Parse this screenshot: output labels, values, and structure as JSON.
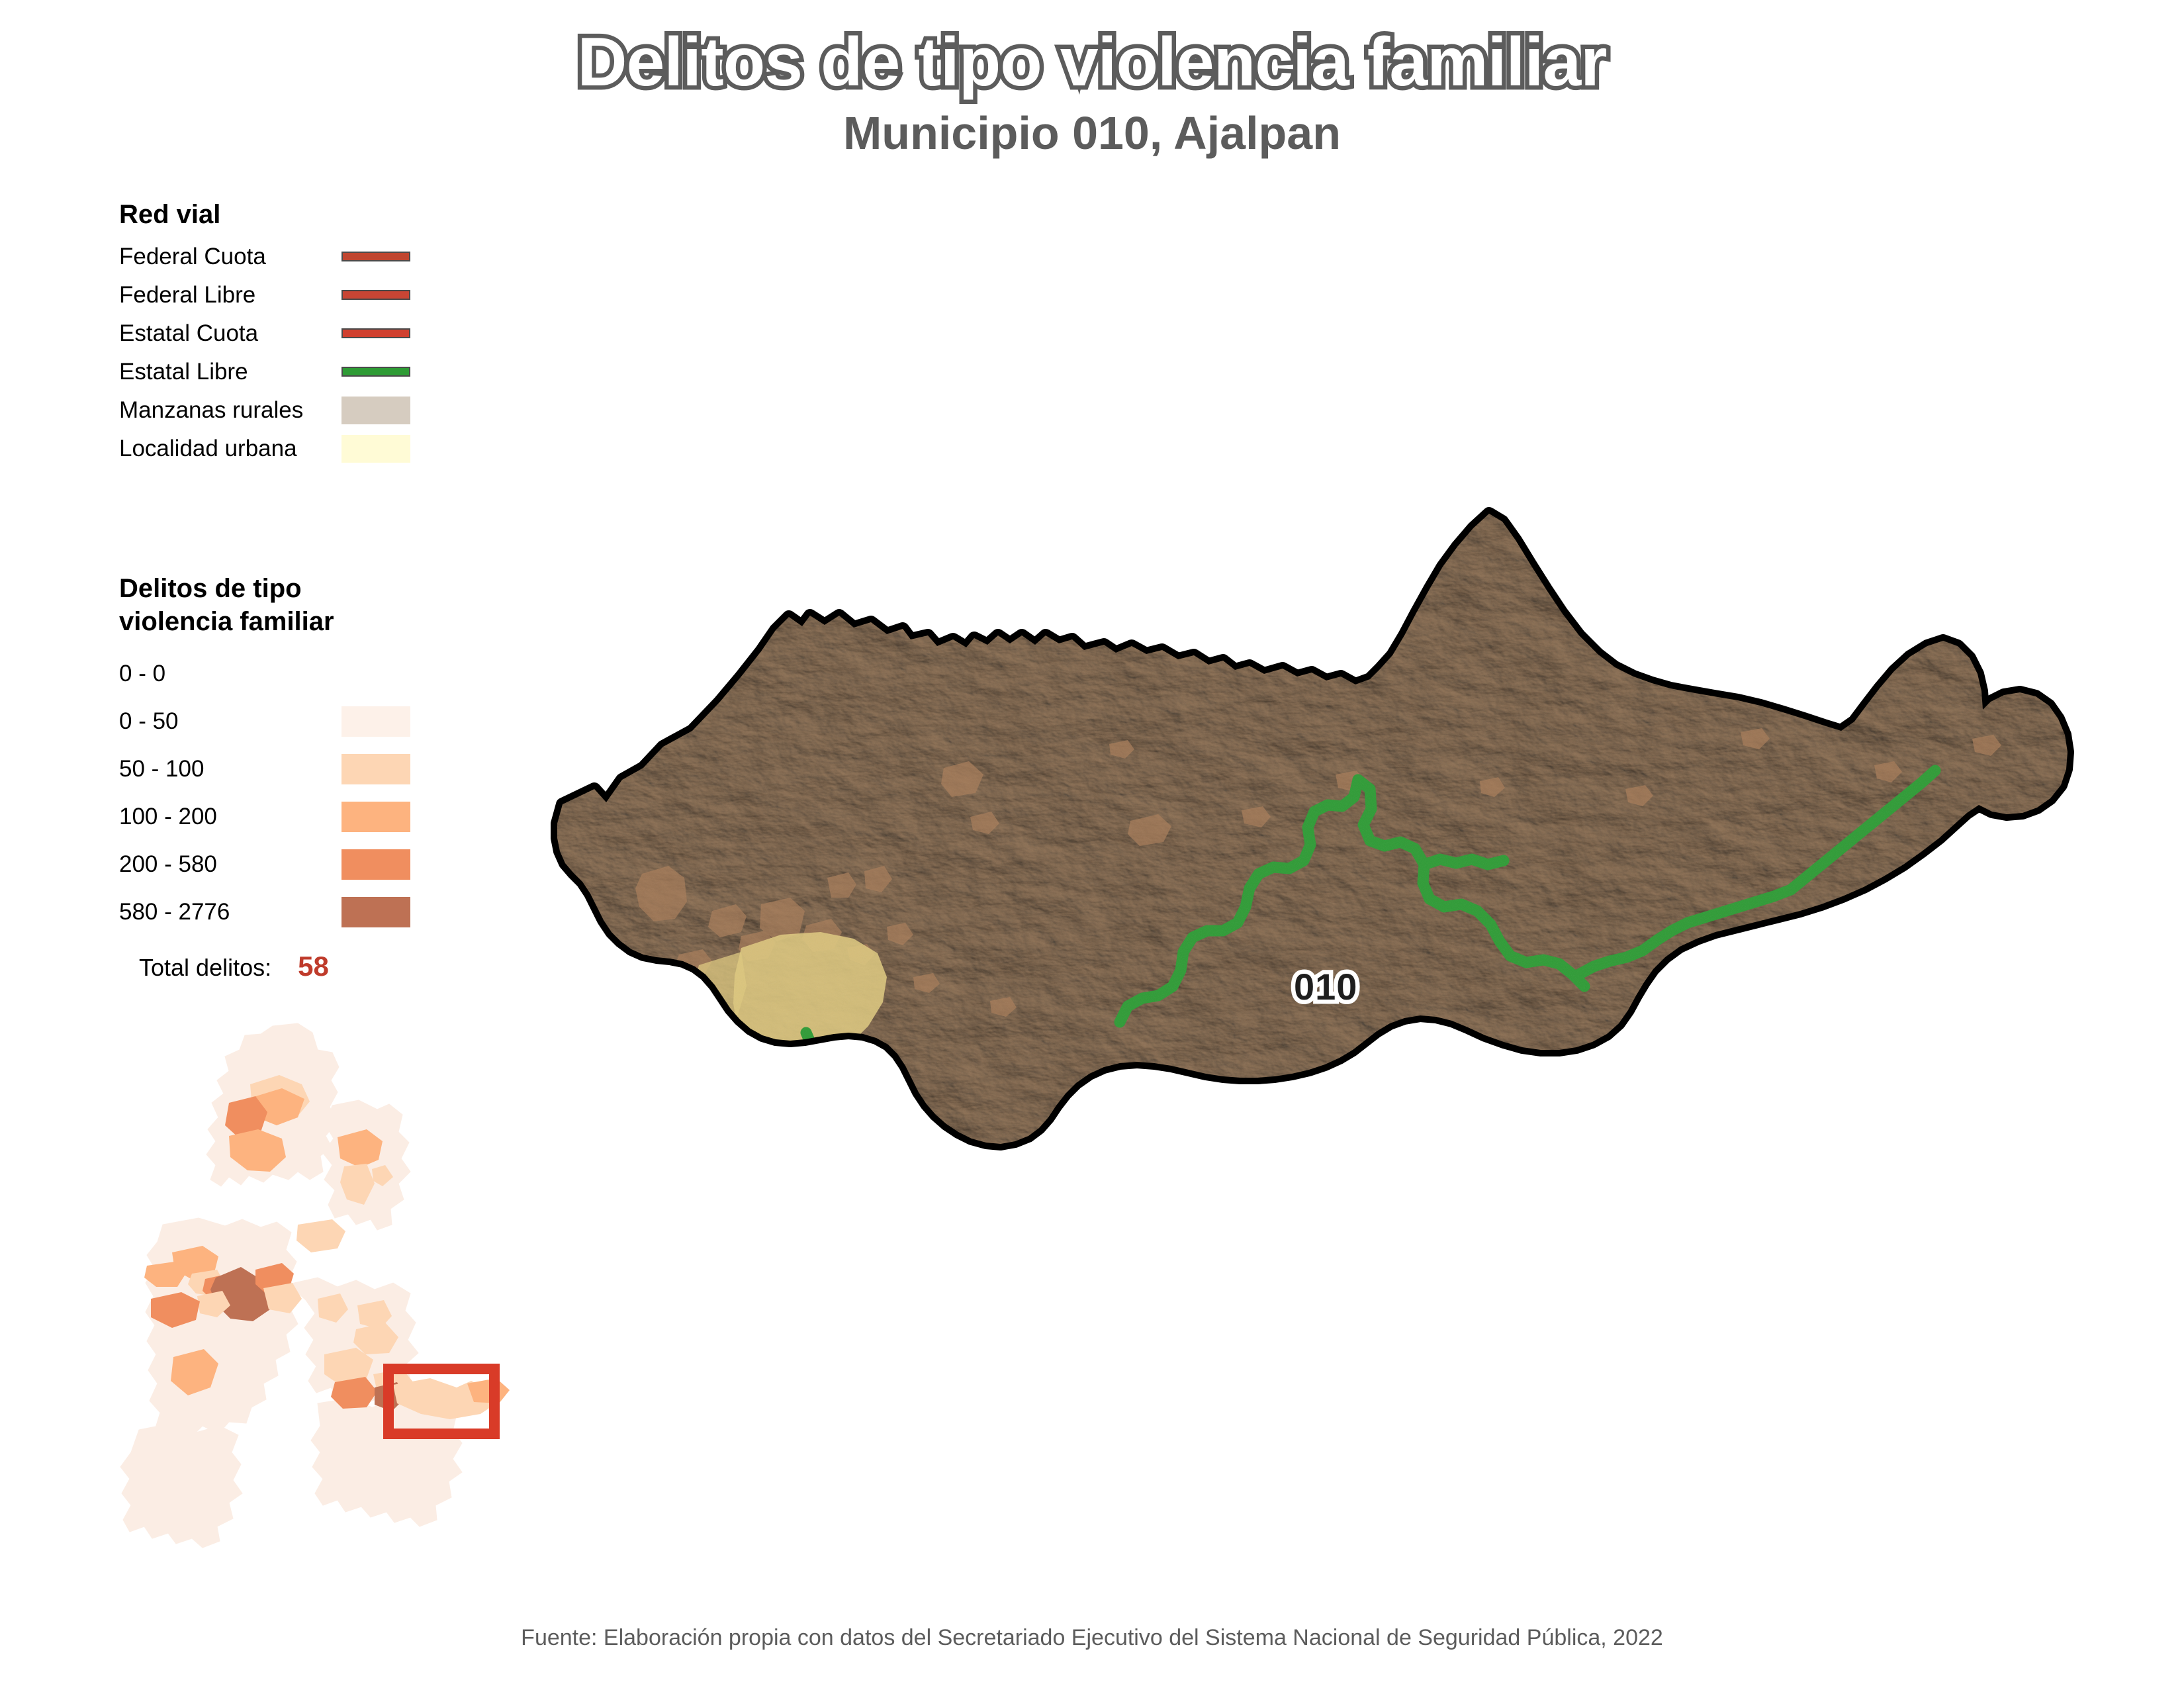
{
  "header": {
    "title": "Delitos de tipo violencia familiar",
    "subtitle": "Municipio 010, Ajalpan",
    "title_fill": "#ffffff",
    "title_stroke": "#5c5c5c",
    "subtitle_color": "#5c5c5c"
  },
  "legend_roads": {
    "heading": "Red vial",
    "items": [
      {
        "label": "Federal Cuota",
        "swatch_type": "line",
        "color": "#C0452F"
      },
      {
        "label": "Federal Libre",
        "swatch_type": "line",
        "color": "#C84534"
      },
      {
        "label": "Estatal Cuota",
        "swatch_type": "line",
        "color": "#D0402F"
      },
      {
        "label": "Estatal Libre",
        "swatch_type": "line",
        "color": "#2E9B35"
      },
      {
        "label": "Manzanas rurales",
        "swatch_type": "box",
        "color": "#D6CCC0"
      },
      {
        "label": "Localidad urbana",
        "swatch_type": "box",
        "color": "#FFFBD6"
      }
    ]
  },
  "legend_choropleth": {
    "heading": "Delitos de tipo violencia familiar",
    "classes": [
      {
        "label": "0 - 0",
        "color": null
      },
      {
        "label": "0 - 50",
        "color": "#FDF1E9"
      },
      {
        "label": "50 - 100",
        "color": "#FDD6B4"
      },
      {
        "label": "100 - 200",
        "color": "#FDB37F"
      },
      {
        "label": "200 - 580",
        "color": "#F08E5F"
      },
      {
        "label": "580 - 2776",
        "color": "#BE7154"
      }
    ],
    "total_label": "Total delitos:",
    "total_value": "58",
    "total_value_color": "#bf3b2b"
  },
  "main_map": {
    "municipio_label": "010",
    "boundary_color": "#000000",
    "boundary_halo": "#ffffff",
    "terrain_base": "#B69878",
    "terrain_shadow": "#6E5B46",
    "urban_locality_color": "#DEC87E",
    "rural_block_color": "#A87C58",
    "state_road_color": "#2E9B35"
  },
  "inset_map": {
    "base_fill": "#FBEDE4",
    "highlight_box_color": "#D93B28",
    "municipality_fills": [
      "#FDF1E9",
      "#FDD6B4",
      "#FDB37F",
      "#F08E5F",
      "#BE7154"
    ]
  },
  "footer": {
    "source": "Fuente: Elaboración propia con datos del Secretariado Ejecutivo del Sistema Nacional de Seguridad Pública, 2022"
  },
  "chart_data": {
    "type": "map",
    "title": "Delitos de tipo violencia familiar",
    "subtitle": "Municipio 010, Ajalpan",
    "measure": "Delitos de tipo violencia familiar",
    "total": 58,
    "class_breaks": [
      0,
      0,
      50,
      100,
      200,
      580,
      2776
    ],
    "class_labels": [
      "0 - 0",
      "0 - 50",
      "50 - 100",
      "100 - 200",
      "200 - 580",
      "580 - 2776"
    ],
    "class_colors": [
      null,
      "#FDF1E9",
      "#FDD6B4",
      "#FDB37F",
      "#F08E5F",
      "#BE7154"
    ],
    "highlighted_feature": {
      "id": "010",
      "name": "Ajalpan",
      "value": 58,
      "class": "50 - 100"
    },
    "source": "Secretariado Ejecutivo del Sistema Nacional de Seguridad Pública, 2022"
  }
}
